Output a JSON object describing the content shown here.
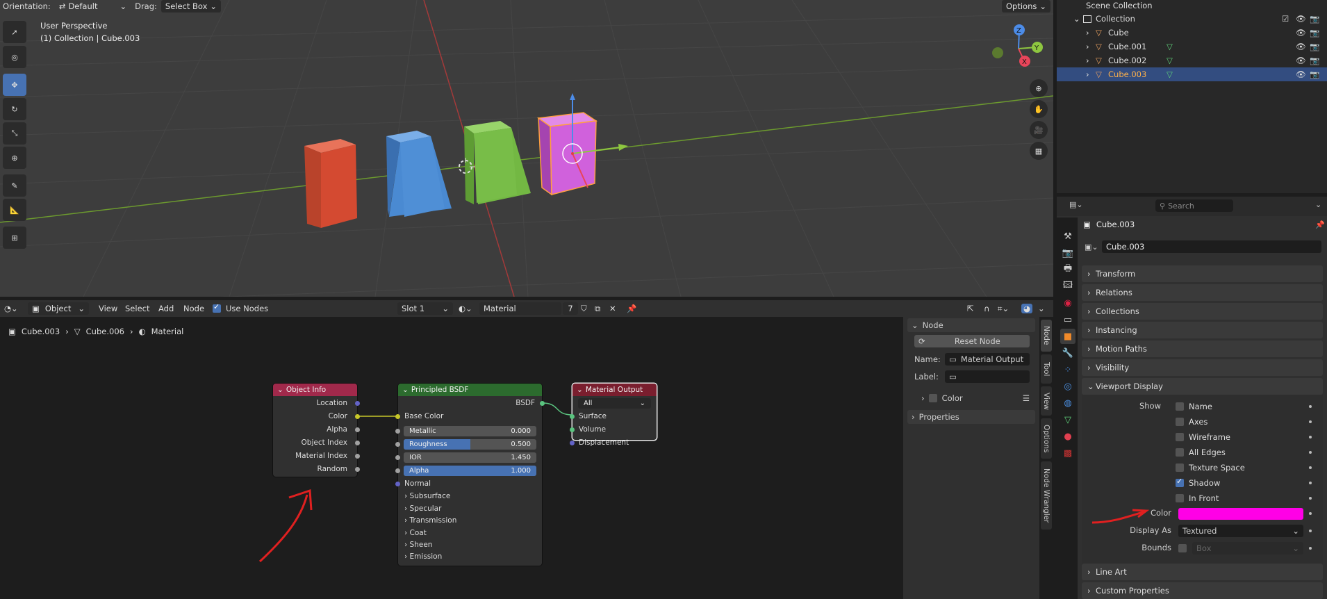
{
  "viewport": {
    "orientation_label": "Orientation:",
    "orientation_value": "Default",
    "drag_label": "Drag:",
    "drag_value": "Select Box",
    "options_label": "Options",
    "perspective": "User Perspective",
    "collection_line": "(1) Collection | Cube.003",
    "gizmo": {
      "z": "Z",
      "y": "Y",
      "x": "X"
    },
    "cube_colors": [
      "#d9533a",
      "#4a90d9",
      "#7cc24a",
      "#d65fe0"
    ]
  },
  "outliner": {
    "scene_collection": "Scene Collection",
    "collection": "Collection",
    "objects": [
      {
        "name": "Cube",
        "selected": false
      },
      {
        "name": "Cube.001",
        "selected": false
      },
      {
        "name": "Cube.002",
        "selected": false
      },
      {
        "name": "Cube.003",
        "selected": true
      }
    ]
  },
  "properties": {
    "search_placeholder": "Search",
    "object_name": "Cube.003",
    "data_name": "Cube.003",
    "panels": [
      "Transform",
      "Relations",
      "Collections",
      "Instancing",
      "Motion Paths",
      "Visibility"
    ],
    "viewport_display": {
      "title": "Viewport Display",
      "show_label": "Show",
      "options": [
        {
          "label": "Name",
          "checked": false
        },
        {
          "label": "Axes",
          "checked": false
        },
        {
          "label": "Wireframe",
          "checked": false
        },
        {
          "label": "All Edges",
          "checked": false
        },
        {
          "label": "Texture Space",
          "checked": false
        },
        {
          "label": "Shadow",
          "checked": true
        },
        {
          "label": "In Front",
          "checked": false
        }
      ],
      "color_label": "Color",
      "color_value": "#ff00e6",
      "display_as_label": "Display As",
      "display_as_value": "Textured",
      "bounds_label": "Bounds",
      "bounds_value": "Box"
    },
    "bottom_panels": [
      "Line Art",
      "Custom Properties"
    ]
  },
  "node_editor": {
    "header": {
      "mode": "Object",
      "view": "View",
      "select": "Select",
      "add": "Add",
      "node": "Node",
      "use_nodes": "Use Nodes",
      "slot": "Slot 1",
      "material": "Material",
      "users": "7"
    },
    "breadcrumb": [
      "Cube.003",
      "Cube.006",
      "Material"
    ],
    "object_info": {
      "title": "Object Info",
      "outputs": [
        "Location",
        "Color",
        "Alpha",
        "Object Index",
        "Material Index",
        "Random"
      ]
    },
    "bsdf": {
      "title": "Principled BSDF",
      "output": "BSDF",
      "base_color": "Base Color",
      "fields": [
        {
          "label": "Metallic",
          "value": "0.000",
          "fill": 0.0
        },
        {
          "label": "Roughness",
          "value": "0.500",
          "fill": 0.5
        },
        {
          "label": "IOR",
          "value": "1.450",
          "fill": 0.0
        },
        {
          "label": "Alpha",
          "value": "1.000",
          "fill": 1.0
        }
      ],
      "normal": "Normal",
      "subpanels": [
        "Subsurface",
        "Specular",
        "Transmission",
        "Coat",
        "Sheen",
        "Emission"
      ]
    },
    "output": {
      "title": "Material Output",
      "target": "All",
      "inputs": [
        "Surface",
        "Volume",
        "Displacement"
      ]
    },
    "npanel": {
      "title": "Node",
      "reset": "Reset Node",
      "name_label": "Name:",
      "name_value": "Material Output",
      "label_label": "Label:",
      "label_value": "",
      "color": "Color",
      "properties": "Properties"
    },
    "tabs": [
      "Node",
      "Tool",
      "View",
      "Options",
      "Node Wrangler"
    ]
  }
}
